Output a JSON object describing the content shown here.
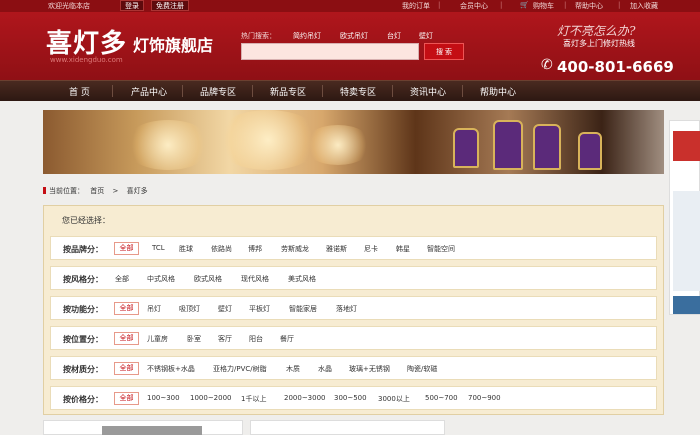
{
  "topbar": {
    "welcome": "欢迎光临本店",
    "login": "登录",
    "register": "免费注册",
    "links": [
      "我的订单",
      "会员中心",
      "购物车",
      "帮助中心",
      "加入收藏"
    ]
  },
  "header": {
    "logo_main": "喜灯多",
    "logo_sub": "灯饰旗舰店",
    "logo_url": "www.xidengduo.com",
    "hot_label": "热门搜索：",
    "hot_links": [
      "简约吊灯",
      "欧式吊灯",
      "台灯",
      "壁灯"
    ],
    "search_placeholder": "",
    "search_button": "搜 索",
    "slogan": "灯不亮怎么办?",
    "slogan2": "喜灯多上门修灯热线",
    "phone": "400-801-6669"
  },
  "nav": [
    "首 页",
    "产品中心",
    "品牌专区",
    "新品专区",
    "特卖专区",
    "资讯中心",
    "帮助中心"
  ],
  "breadcrumb": {
    "label": "当前位置：",
    "home": "首页",
    "separator": ">",
    "current": "喜灯多"
  },
  "filter": {
    "title": "您已经选择：",
    "all_label": "全部",
    "rows": [
      {
        "label": "按品牌分：",
        "options": [
          "全部",
          "TCL",
          "胜球",
          "依路尚",
          "博邦",
          "劳斯威龙",
          "雅诺斯",
          "尼卡",
          "韩星",
          "智能空间"
        ]
      },
      {
        "label": "按风格分：",
        "options": [
          "全部",
          "中式风格",
          "欧式风格",
          "现代风格",
          "美式风格"
        ]
      },
      {
        "label": "按功能分：",
        "options": [
          "全部",
          "吊灯",
          "吸顶灯",
          "壁灯",
          "平板灯",
          "智能家居",
          "落地灯"
        ]
      },
      {
        "label": "按位置分：",
        "options": [
          "全部",
          "儿童房",
          "卧室",
          "客厅",
          "阳台",
          "餐厅"
        ]
      },
      {
        "label": "按材质分：",
        "options": [
          "全部",
          "不锈钢板+水晶",
          "亚格力/PVC/树脂",
          "木质",
          "水晶",
          "玻璃+无锈钢",
          "陶瓷/软磁"
        ]
      },
      {
        "label": "按价格分：",
        "options": [
          "全部",
          "100~300",
          "1000~2000",
          "1千以上",
          "2000~3000",
          "300~500",
          "3000以上",
          "500~700",
          "700~900"
        ]
      }
    ]
  },
  "colors": {
    "brand_red": "#8b0e12",
    "nav_brown": "#3a2018",
    "panel_bg": "#f7ecd2",
    "accent": "#c40e14"
  }
}
